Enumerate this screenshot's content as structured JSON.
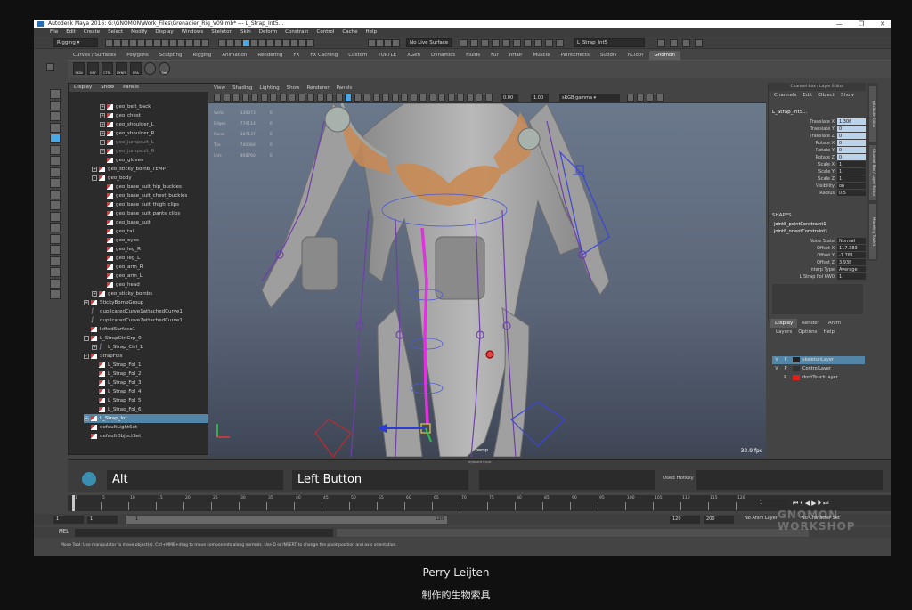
{
  "window": {
    "title": "Autodesk Maya 2016: G:\\GNOMON\\Work_Files\\Grenadier_Rig_V09.mb* --- L_Strap_Int5..."
  },
  "menu": [
    "File",
    "Edit",
    "Create",
    "Select",
    "Modify",
    "Display",
    "Windows",
    "Skeleton",
    "Skin",
    "Deform",
    "Constrain",
    "Control",
    "Cache",
    "Help"
  ],
  "status": {
    "mode": "Rigging",
    "live_surface": "No Live Surface",
    "selected_field": "L_Strap_Int5"
  },
  "shelf": {
    "tabs": [
      "Curves / Surfaces",
      "Polygons",
      "Sculpting",
      "Rigging",
      "Animation",
      "Rendering",
      "FX",
      "FX Caching",
      "Custom",
      "TURTLE",
      "XGen",
      "Dynamics",
      "Fluids",
      "Fur",
      "nHair",
      "Muscle",
      "PaintEffects",
      "Subdiv",
      "nCloth",
      "Gnomon"
    ],
    "active_tab": "Gnomon",
    "buttons": [
      "SKIN",
      "KEY",
      "CTRL",
      "DYNFK",
      "ERA",
      "",
      "Set"
    ]
  },
  "outliner": {
    "menu": [
      "Display",
      "Show",
      "Panels"
    ],
    "rows": [
      {
        "label": "geo_belt_back",
        "indent": 3,
        "expander": "+",
        "state": ""
      },
      {
        "label": "geo_chest",
        "indent": 3,
        "expander": "+",
        "state": ""
      },
      {
        "label": "geo_shoulder_L",
        "indent": 3,
        "expander": "+",
        "state": ""
      },
      {
        "label": "geo_shoulder_R",
        "indent": 3,
        "expander": "+",
        "state": ""
      },
      {
        "label": "geo_jumpsuit_L",
        "indent": 3,
        "expander": "+",
        "state": "dim"
      },
      {
        "label": "geo_jumpsuit_R",
        "indent": 3,
        "expander": "+",
        "state": "dim"
      },
      {
        "label": "geo_gloves",
        "indent": 3,
        "expander": "",
        "state": ""
      },
      {
        "label": "geo_sticky_bomb_TEMP",
        "indent": 2,
        "expander": "+",
        "state": ""
      },
      {
        "label": "geo_body",
        "indent": 2,
        "expander": "-",
        "state": ""
      },
      {
        "label": "geo_base_suit_hip_buckles",
        "indent": 3,
        "expander": "",
        "state": ""
      },
      {
        "label": "geo_base_suit_chest_buckles",
        "indent": 3,
        "expander": "",
        "state": ""
      },
      {
        "label": "geo_base_suit_thigh_clips",
        "indent": 3,
        "expander": "",
        "state": ""
      },
      {
        "label": "geo_base_suit_pants_clips",
        "indent": 3,
        "expander": "",
        "state": ""
      },
      {
        "label": "geo_base_suit",
        "indent": 3,
        "expander": "",
        "state": ""
      },
      {
        "label": "geo_tail",
        "indent": 3,
        "expander": "",
        "state": ""
      },
      {
        "label": "geo_eyes",
        "indent": 3,
        "expander": "",
        "state": ""
      },
      {
        "label": "geo_leg_R",
        "indent": 3,
        "expander": "",
        "state": ""
      },
      {
        "label": "geo_leg_L",
        "indent": 3,
        "expander": "",
        "state": ""
      },
      {
        "label": "geo_arm_R",
        "indent": 3,
        "expander": "",
        "state": ""
      },
      {
        "label": "geo_arm_L",
        "indent": 3,
        "expander": "",
        "state": ""
      },
      {
        "label": "geo_head",
        "indent": 3,
        "expander": "",
        "state": ""
      },
      {
        "label": "geo_sticky_bombs",
        "indent": 2,
        "expander": "+",
        "state": ""
      },
      {
        "label": "StickyBombGroup",
        "indent": 1,
        "expander": "+",
        "state": ""
      },
      {
        "label": "duplicatedCurve1attachedCurve1",
        "indent": 1,
        "expander": "",
        "state": "curve"
      },
      {
        "label": "duplicatedCurve2attachedCurve1",
        "indent": 1,
        "expander": "",
        "state": "curve"
      },
      {
        "label": "loftedSurface1",
        "indent": 1,
        "expander": "",
        "state": ""
      },
      {
        "label": "L_StrapCtrlGrp_0",
        "indent": 1,
        "expander": "-",
        "state": ""
      },
      {
        "label": "L_Strap_Ctrl_1",
        "indent": 2,
        "expander": "+",
        "state": "curve"
      },
      {
        "label": "StrapFols",
        "indent": 1,
        "expander": "-",
        "state": ""
      },
      {
        "label": "L_Strap_Fol_1",
        "indent": 2,
        "expander": "",
        "state": ""
      },
      {
        "label": "L_Strap_Fol_2",
        "indent": 2,
        "expander": "",
        "state": ""
      },
      {
        "label": "L_Strap_Fol_3",
        "indent": 2,
        "expander": "",
        "state": ""
      },
      {
        "label": "L_Strap_Fol_4",
        "indent": 2,
        "expander": "",
        "state": ""
      },
      {
        "label": "L_Strap_Fol_5",
        "indent": 2,
        "expander": "",
        "state": ""
      },
      {
        "label": "L_Strap_Fol_6",
        "indent": 2,
        "expander": "",
        "state": ""
      },
      {
        "label": "L_Strap_Int",
        "indent": 1,
        "expander": "+",
        "state": "sel"
      },
      {
        "label": "defaultLightSet",
        "indent": 1,
        "expander": "",
        "state": ""
      },
      {
        "label": "defaultObjectSet",
        "indent": 1,
        "expander": "",
        "state": ""
      }
    ]
  },
  "viewport": {
    "menu": [
      "View",
      "Shading",
      "Lighting",
      "Show",
      "Renderer",
      "Panels"
    ],
    "gamma": "sRGB gamma",
    "exposure": "0.00",
    "gamma_value": "1.00",
    "hud": [
      {
        "label": "Verts",
        "a": "336373",
        "b": "0"
      },
      {
        "label": "Edges",
        "a": "770114",
        "b": "0"
      },
      {
        "label": "Faces",
        "a": "387137",
        "b": "0"
      },
      {
        "label": "Tris",
        "a": "740084",
        "b": "0"
      },
      {
        "label": "UVs",
        "a": "908760",
        "b": "0"
      }
    ],
    "camera": "persp",
    "fps": "32.9 fps"
  },
  "channel_box": {
    "header": "Channel Box / Layer Editor",
    "menu": [
      "Channels",
      "Edit",
      "Object",
      "Show"
    ],
    "object": "L_Strap_Int5...",
    "attrs": [
      {
        "name": "Translate X",
        "value": "1.306",
        "hl": true
      },
      {
        "name": "Translate Y",
        "value": "0",
        "hl": true
      },
      {
        "name": "Translate Z",
        "value": "0",
        "hl": true
      },
      {
        "name": "Rotate X",
        "value": "0",
        "hl": true
      },
      {
        "name": "Rotate Y",
        "value": "0",
        "hl": true
      },
      {
        "name": "Rotate Z",
        "value": "0",
        "hl": true
      },
      {
        "name": "Scale X",
        "value": "1",
        "hl": false
      },
      {
        "name": "Scale Y",
        "value": "1",
        "hl": false
      },
      {
        "name": "Scale Z",
        "value": "1",
        "hl": false
      },
      {
        "name": "Visibility",
        "value": "on",
        "hl": false
      },
      {
        "name": "Radius",
        "value": "0.5",
        "hl": false
      }
    ],
    "shapes_label": "SHAPES",
    "constraints": [
      "joint8_pointConstraint1",
      "joint8_orientConstraint1"
    ],
    "constraint_attrs": [
      {
        "name": "Node State",
        "value": "Normal"
      },
      {
        "name": "Offset X",
        "value": "117.383"
      },
      {
        "name": "Offset Y",
        "value": "-1.781"
      },
      {
        "name": "Offset Z",
        "value": "3.938"
      },
      {
        "name": "Interp Type",
        "value": "Average"
      },
      {
        "name": "L Strap Fol 6W0",
        "value": "1"
      }
    ],
    "side_tabs": [
      "Attribute Editor",
      "Channel Box / Layer Editor",
      "Modeling Toolkit"
    ]
  },
  "layers": {
    "tabs": [
      "Display",
      "Render",
      "Anim"
    ],
    "menu": [
      "Layers",
      "Options",
      "Help"
    ],
    "rows": [
      {
        "v": "V",
        "p": "P",
        "name": "skeletonLayer",
        "color": "#222222",
        "sel": true
      },
      {
        "v": "V",
        "p": "P",
        "name": "ControlLayer",
        "color": "#333333",
        "sel": false
      },
      {
        "v": "",
        "p": "R",
        "name": "dontTouchLayer",
        "color": "#e0201c",
        "sel": false
      }
    ]
  },
  "hotkey": {
    "title": "Keyboard Input",
    "key1": "Alt",
    "key2": "Left Button",
    "key3": "",
    "used_label": "Used Hotkey"
  },
  "time": {
    "ticks": [
      "1",
      "5",
      "10",
      "15",
      "20",
      "25",
      "30",
      "35",
      "40",
      "45",
      "50",
      "55",
      "60",
      "65",
      "70",
      "75",
      "80",
      "85",
      "90",
      "95",
      "100",
      "105",
      "110",
      "115",
      "120"
    ],
    "current_frame": "1",
    "range_start": "1",
    "range_start2": "1",
    "range_inner": "1",
    "range_mid": "120",
    "range_end": "120",
    "range_end2": "200",
    "anim_layer": "No Anim Layer",
    "char_set": "No Character Set"
  },
  "mel": {
    "label": "MEL"
  },
  "helpline": "Move Tool: Use manipulator to move object(s). Ctrl+MMB+drag to move components along normals. Use D or INSERT to change the pivot position and axis orientation.",
  "watermark": [
    "GNOMON",
    "WORKSHOP"
  ],
  "credit": {
    "name": "Perry Leijten",
    "caption": "制作的生物索具"
  },
  "colors": {
    "accent_blue": "#5285a6",
    "rig_purple": "#6f3fa8",
    "rig_magenta": "#e232e0",
    "armor_orange": "#c98a54"
  }
}
